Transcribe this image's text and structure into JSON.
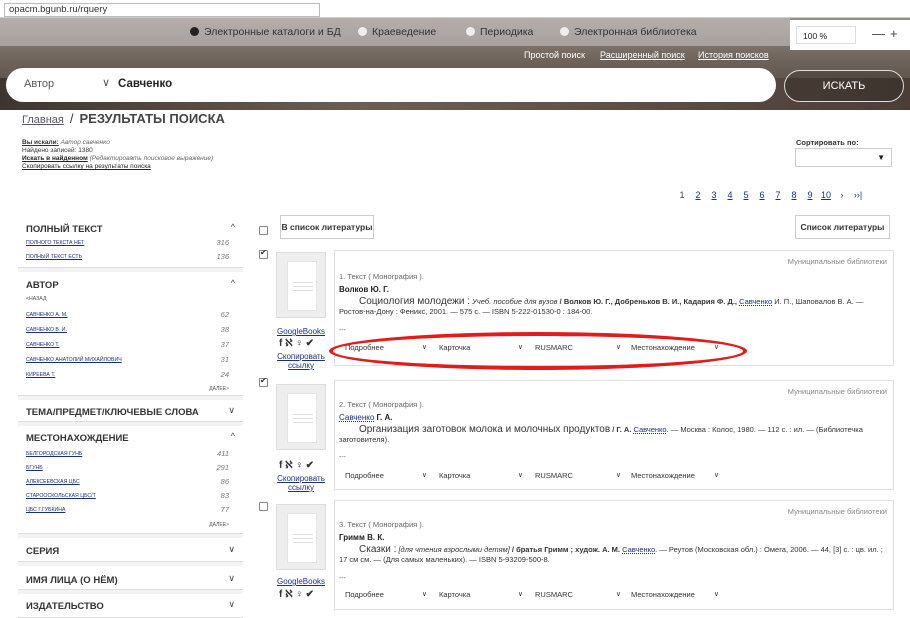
{
  "browser": {
    "url": "opacm.bgunb.ru/rquery"
  },
  "header": {
    "categories": [
      "Электронные каталоги и БД",
      "Краеведение",
      "Периодика",
      "Электронная библиотека"
    ],
    "zoom": "100 %",
    "zoom_minus": "—",
    "zoom_plus": "+",
    "modes": [
      "Простой поиск",
      "Расширенный поиск",
      "История поисков"
    ],
    "search_field": "Автор",
    "search_query": "Савченко",
    "search_button": "ИСКАТЬ"
  },
  "breadcrumb": {
    "home": "Главная",
    "sep": "/",
    "current": "РЕЗУЛЬТАТЫ ПОИСКА"
  },
  "search_info": {
    "searched_label": "Вы искали:",
    "searched_value": "Автор савченко",
    "found_label": "Найдено записей:",
    "found_value": "1380",
    "refine_label": "Искать в найденном",
    "refine_hint": "(Редактировать поисковое выражение)",
    "copy_link": "Скопировать ссылку на результаты поиска"
  },
  "sort": {
    "label": "Сортировать по:",
    "value": ""
  },
  "pager": {
    "pages": [
      "1",
      "2",
      "3",
      "4",
      "5",
      "6",
      "7",
      "8",
      "9",
      "10"
    ],
    "current": "1",
    "next": "›",
    "last": "››|"
  },
  "sidebar": {
    "full_text": {
      "title": "ПОЛНЫЙ ТЕКСТ",
      "items": [
        {
          "label": "ПОЛНОГО ТЕКСТА НЕТ",
          "count": "316"
        },
        {
          "label": "ПОЛНЫЙ ТЕКСТ ЕСТЬ",
          "count": "136"
        }
      ]
    },
    "author": {
      "title": "АВТОР",
      "back": "<НАЗАД",
      "items": [
        {
          "label": "САВЧЕНКО А. М.",
          "count": "62"
        },
        {
          "label": "САВЧЕНКО В. И.",
          "count": "38"
        },
        {
          "label": "САВЧЕНКО Т.",
          "count": "37"
        },
        {
          "label": "САВЧЕНКО АНАТОЛИЙ МИХАЙЛОВИЧ",
          "count": "31"
        },
        {
          "label": "КИРЕЕВА Т.",
          "count": "24"
        }
      ],
      "more": "ДАЛЕЕ>"
    },
    "topic": {
      "title": "ТЕМА/ПРЕДМЕТ/КЛЮЧЕВЫЕ СЛОВА"
    },
    "location": {
      "title": "МЕСТОНАХОЖДЕНИЕ",
      "items": [
        {
          "label": "БЕЛГОРОДСКАЯ ГУНБ",
          "count": "411"
        },
        {
          "label": "БГУНБ",
          "count": "291"
        },
        {
          "label": "АЛЕКСЕЕВСКАЯ ЦБС",
          "count": "86"
        },
        {
          "label": "СТАРООСКОЛЬСКАЯ ЦБС/Т",
          "count": "83"
        },
        {
          "label": "ЦБС Г.ГУБКИНА",
          "count": "77"
        }
      ],
      "more": "ДАЛЕЕ>"
    },
    "series": {
      "title": "СЕРИЯ"
    },
    "person": {
      "title": "ИМЯ ЛИЦА (О НЁМ)"
    },
    "publisher": {
      "title": "ИЗДАТЕЛЬСТВО"
    }
  },
  "toolbar": {
    "add_to_list": "В список литературы",
    "list": "Список литературы"
  },
  "records": [
    {
      "library": "Муниципальные библиотеки",
      "type": "1. Текст ( Монография ).",
      "author": "Волков Ю. Г.",
      "title": "Социология молодежи :",
      "desc_parts": [
        " Учеб. пособие для вузов",
        " / Волков Ю. Г., Добреньков В. И., Кадария Ф. Д., ",
        "Савченко",
        " И. П., Шаповалов В. А. — Ростов-на-Дону : Феникс, 2001. — 575 с. — ISBN 5-222-01530-0 : 184-00."
      ],
      "dash": "---",
      "google": "GoogleBooks",
      "copy": "Скопировать ссылку",
      "dd": [
        "Подробнее",
        "Карточка",
        "RUSMARC",
        "Местонахождение"
      ],
      "checked": true
    },
    {
      "library": "Муниципальные библиотеки",
      "type": "2. Текст ( Монография ).",
      "author_link": "Савченко",
      "author_rest": " Г. А.",
      "title": "Организация заготовок молока и молочных продуктов",
      "desc_parts": [
        " / Г. А. ",
        "Савченко",
        ". — Москва : Колос, 1980. — 112 с. : ил. — (Библиотечка заготовителя)."
      ],
      "dash": "---",
      "copy": "Скопировать ссылку",
      "dd": [
        "Подробнее",
        "Карточка",
        "RUSMARC",
        "Местонахождение"
      ],
      "checked": true
    },
    {
      "library": "Муниципальные библиотеки",
      "type": "3. Текст ( Монография ).",
      "author": "Гримм В. К.",
      "title": "Сказки :",
      "desc_parts": [
        " [для чтения взрослыми детям]",
        " / братья Гримм ; худож. А. М. ",
        "Савченко",
        ". — Реутов (Московская обл.) : Омега, 2006. — 44, [3] с. : цв. ил. ; 17 см см. — (Для самых маленьких). — ISBN 5-93209-500-8."
      ],
      "dash": "---",
      "google": "GoogleBooks",
      "dd": [
        "Подробнее",
        "Карточка",
        "RUSMARC",
        "Местонахождение"
      ],
      "checked": false
    }
  ],
  "social": "f ℵ ♀ ✔",
  "colors": {
    "link": "#1a2f80",
    "annotation": "#e41b1b"
  }
}
